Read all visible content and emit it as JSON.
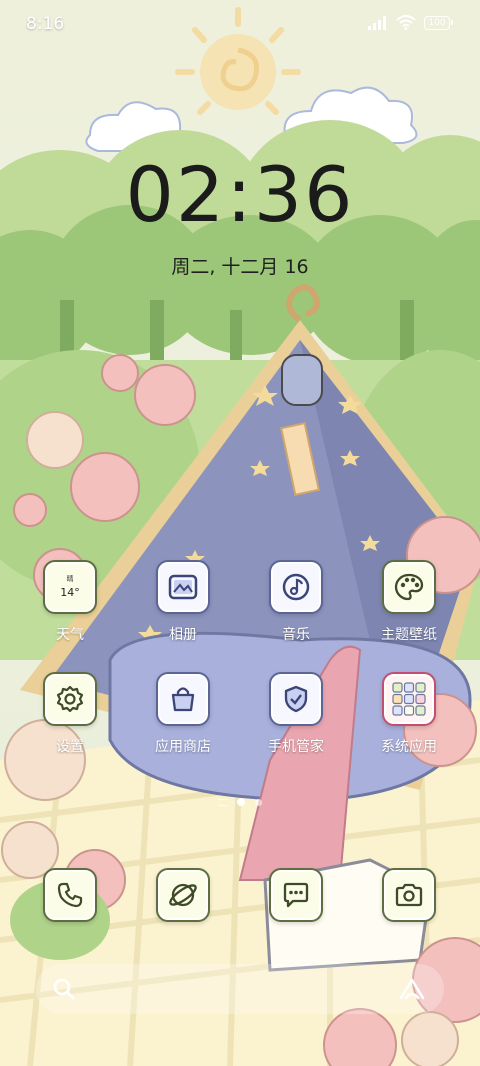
{
  "status_bar": {
    "time": "8:16",
    "battery": "100"
  },
  "lockscreen": {
    "time": "02:36",
    "date": "周二, 十二月 16"
  },
  "weather_widget": {
    "condition": "晴",
    "temperature": "14°"
  },
  "apps_row1": [
    {
      "label": "天气",
      "icon": "weather-icon"
    },
    {
      "label": "相册",
      "icon": "gallery-icon"
    },
    {
      "label": "音乐",
      "icon": "music-icon"
    },
    {
      "label": "主题壁纸",
      "icon": "palette-icon"
    }
  ],
  "apps_row2": [
    {
      "label": "设置",
      "icon": "gear-icon"
    },
    {
      "label": "应用商店",
      "icon": "shopping-bag-icon"
    },
    {
      "label": "手机管家",
      "icon": "shield-icon"
    },
    {
      "label": "系统应用",
      "icon": "folder-icon"
    }
  ],
  "dock": [
    {
      "icon": "phone-icon"
    },
    {
      "icon": "browser-icon"
    },
    {
      "icon": "messages-icon"
    },
    {
      "icon": "camera-icon"
    }
  ],
  "page_indicator": {
    "pages": 2,
    "current": 1
  },
  "search_bar": {
    "left_icon": "search-icon",
    "right_icon": "assistant-icon"
  },
  "colors": {
    "tile_green": "#5e6e40",
    "tile_blue": "#5b6696",
    "tile_pink": "#c24f70"
  }
}
